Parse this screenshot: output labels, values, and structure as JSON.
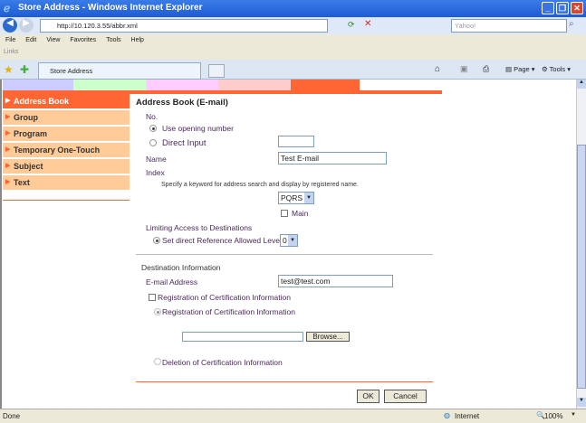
{
  "window": {
    "title": "Store Address - Windows Internet Explorer"
  },
  "browser": {
    "url": "http://10.120.3.55/abbr.xml",
    "search_placeholder": "Yahoo!",
    "menu": [
      "File",
      "Edit",
      "View",
      "Favorites",
      "Tools",
      "Help"
    ],
    "links_label": "Links",
    "tab_title": "Store Address",
    "page_label": "Page",
    "tools_label": "Tools"
  },
  "sidebar": {
    "items": [
      {
        "label": "Address Book"
      },
      {
        "label": "Group"
      },
      {
        "label": "Program"
      },
      {
        "label": "Temporary One-Touch"
      },
      {
        "label": "Subject"
      },
      {
        "label": "Text"
      }
    ]
  },
  "form": {
    "title": "Address Book (E-mail)",
    "no_label": "No.",
    "use_opening": "Use opening number",
    "direct_input": "Direct Input",
    "direct_input_value": "",
    "name_label": "Name",
    "name_value": "Test E-mail",
    "index_label": "Index",
    "index_hint": "Specify a keyword for address search and display by registered name.",
    "index_value": "PQRS",
    "main_label": "Main",
    "limit_label": "Limiting Access to Destinations",
    "limit_option": "Set direct Reference Allowed Level",
    "level_value": "0",
    "dest_label": "Destination Information",
    "email_label": "E-mail Address",
    "email_value": "test@test.com",
    "cert_check": "Registration of Certification Information",
    "cert_register": "Registration of Certification Information",
    "browse": "Browse...",
    "cert_delete": "Deletion of Certification Information",
    "ok": "OK",
    "cancel": "Cancel"
  },
  "status": {
    "left": "Done",
    "zone": "Internet",
    "zoom": "100%"
  },
  "colors": {
    "accent": "#ff6633",
    "side": "#ffcc99"
  }
}
